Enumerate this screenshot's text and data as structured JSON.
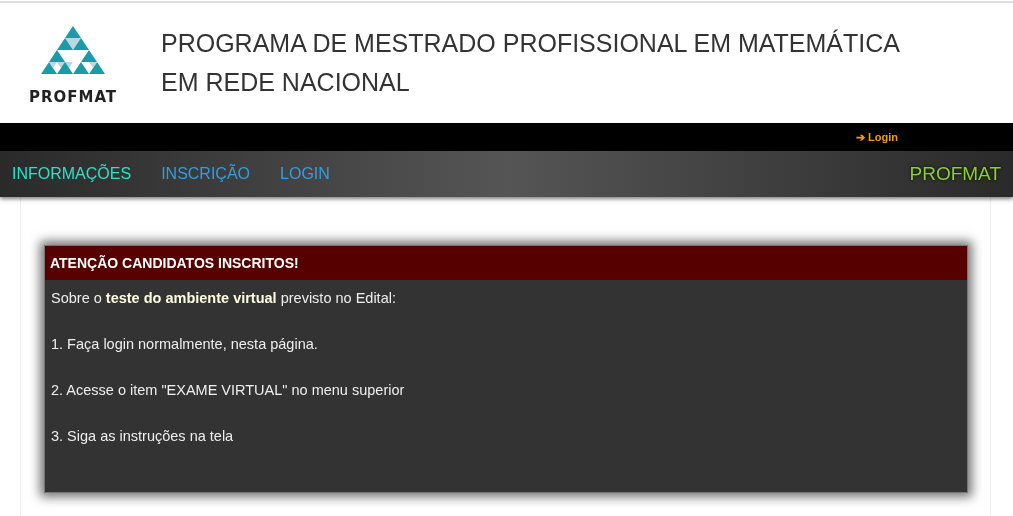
{
  "header": {
    "logo_text": "PROFMAT",
    "title_lines": [
      "PROGRAMA DE MESTRADO PROFISSIONAL EM MATEMÁTICA",
      "EM REDE NACIONAL"
    ]
  },
  "top_bar": {
    "icon": "➔",
    "link": "Login"
  },
  "nav": {
    "items": [
      {
        "label": "INFORMAÇÕES",
        "selected": true
      },
      {
        "label": "INSCRIÇÃO",
        "selected": false
      },
      {
        "label": "LOGIN",
        "selected": false
      }
    ],
    "brand": "PROFMAT"
  },
  "notice": {
    "title": "ATENÇÃO CANDIDATOS INSCRITOS!",
    "paragraphs": [
      "Sobre o **teste do ambiente virtual** previsto no Edital:",
      "1. Faça login normalmente, nesta página.",
      "2. Acesse o item \"EXAME VIRTUAL\" no menu superior",
      "3. Siga as instruções na tela"
    ]
  }
}
